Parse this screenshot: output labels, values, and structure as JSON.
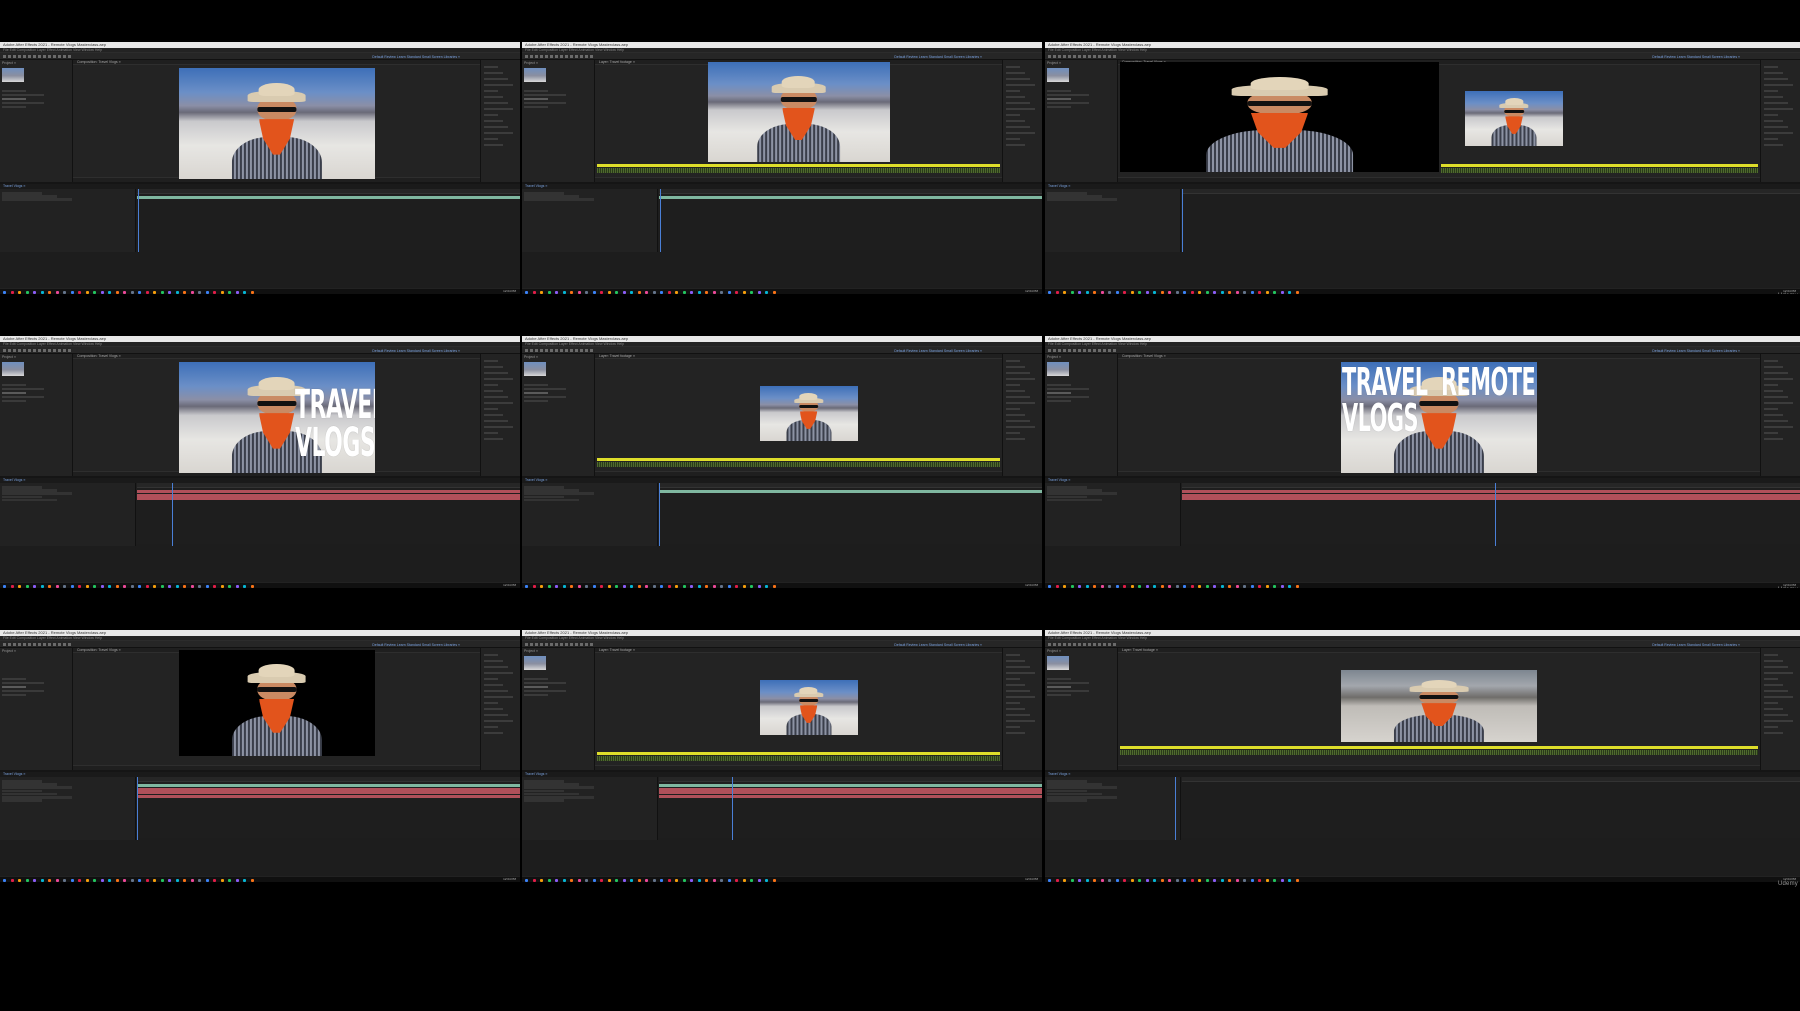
{
  "watermark": "Udemy",
  "app": {
    "title": "Adobe After Effects 2021 - Remote Vlogs Masterclass.aep",
    "menu": "File  Edit  Composition  Layer  Effect  Animation  View  Window  Help",
    "workspaces": "Default  Review  Learn  Standard  Small Screen  Libraries  »",
    "project_tab": "Project ≡",
    "composition_tab": "Composition: Travel Vlogs ≡",
    "layer_tab": "Layer: Travel footage ≡",
    "timeline_tab": "Travel Vlogs ≡",
    "clock": "12:04 PM"
  },
  "overlay_texts": {
    "travel": "TRAVEL",
    "vlogs": "VLOGS",
    "remote": "REMOTE"
  },
  "colors": {
    "ui_bg": "#1d1d1d",
    "panel_bg": "#232323",
    "workarea_yellow": "#dede2a",
    "layer_teal": "#7fb7a0",
    "layer_red": "#b0505a",
    "playhead_blue": "#4a7fd6",
    "bandana_orange": "#e2541c"
  },
  "cells": [
    {
      "id": "r1c1",
      "variant": "comp-scene",
      "title": false
    },
    {
      "id": "r1c2",
      "variant": "layer-scene",
      "title": false
    },
    {
      "id": "r1c3",
      "variant": "roto-black-plus-layer",
      "title": false
    },
    {
      "id": "r2c1",
      "variant": "comp-title",
      "title": "travel-vlogs"
    },
    {
      "id": "r2c2",
      "variant": "layer-small",
      "title": false
    },
    {
      "id": "r2c3",
      "variant": "comp-title-remote",
      "title": "travel-remote-vlogs"
    },
    {
      "id": "r3c1",
      "variant": "comp-black",
      "title": false
    },
    {
      "id": "r3c2",
      "variant": "layer-small",
      "title": false
    },
    {
      "id": "r3c3",
      "variant": "layer-gray",
      "title": false
    }
  ]
}
